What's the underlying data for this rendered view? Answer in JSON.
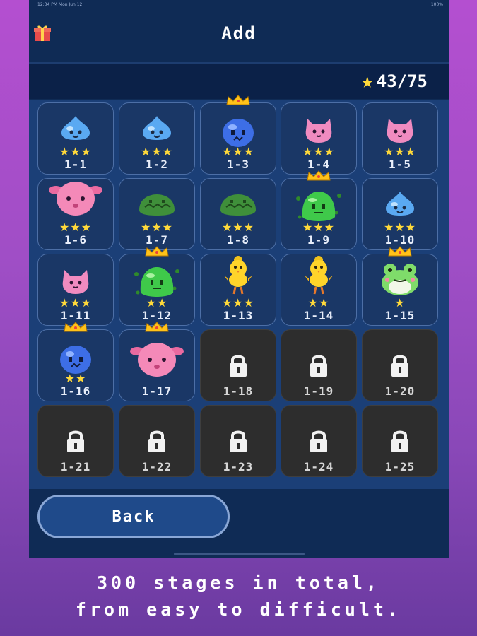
{
  "status_bar": {
    "time": "12:34 PM  Mon Jun 12",
    "battery": "100%"
  },
  "header": {
    "title": "Add"
  },
  "star_total": {
    "value": "43/75"
  },
  "stages": [
    {
      "id": "1-1",
      "stars": "★★★",
      "locked": false,
      "mascot": "blue-slime",
      "crown": false
    },
    {
      "id": "1-2",
      "stars": "★★★",
      "locked": false,
      "mascot": "blue-slime",
      "crown": false
    },
    {
      "id": "1-3",
      "stars": "★★★",
      "locked": false,
      "mascot": "blue-blob",
      "crown": true
    },
    {
      "id": "1-4",
      "stars": "★★★",
      "locked": false,
      "mascot": "pink-cat",
      "crown": false
    },
    {
      "id": "1-5",
      "stars": "★★★",
      "locked": false,
      "mascot": "pink-cat",
      "crown": false
    },
    {
      "id": "1-6",
      "stars": "★★★",
      "locked": false,
      "mascot": "pink-bunny",
      "crown": false
    },
    {
      "id": "1-7",
      "stars": "★★★",
      "locked": false,
      "mascot": "green-slime",
      "crown": false
    },
    {
      "id": "1-8",
      "stars": "★★★",
      "locked": false,
      "mascot": "green-slime",
      "crown": false
    },
    {
      "id": "1-9",
      "stars": "★★★",
      "locked": false,
      "mascot": "green-jelly",
      "crown": true
    },
    {
      "id": "1-10",
      "stars": "★★★",
      "locked": false,
      "mascot": "blue-slime",
      "crown": false
    },
    {
      "id": "1-11",
      "stars": "★★★",
      "locked": false,
      "mascot": "pink-cat",
      "crown": false
    },
    {
      "id": "1-12",
      "stars": "★★",
      "locked": false,
      "mascot": "green-jelly",
      "crown": true
    },
    {
      "id": "1-13",
      "stars": "★★★",
      "locked": false,
      "mascot": "yellow-chick",
      "crown": false
    },
    {
      "id": "1-14",
      "stars": "★★",
      "locked": false,
      "mascot": "yellow-chick",
      "crown": false
    },
    {
      "id": "1-15",
      "stars": "★",
      "locked": false,
      "mascot": "green-frog",
      "crown": true
    },
    {
      "id": "1-16",
      "stars": "★★",
      "locked": false,
      "mascot": "blue-blob",
      "crown": true
    },
    {
      "id": "1-17",
      "stars": "",
      "locked": false,
      "mascot": "pink-bunny",
      "crown": true
    },
    {
      "id": "1-18",
      "stars": "",
      "locked": true
    },
    {
      "id": "1-19",
      "stars": "",
      "locked": true
    },
    {
      "id": "1-20",
      "stars": "",
      "locked": true
    },
    {
      "id": "1-21",
      "stars": "",
      "locked": true
    },
    {
      "id": "1-22",
      "stars": "",
      "locked": true
    },
    {
      "id": "1-23",
      "stars": "",
      "locked": true
    },
    {
      "id": "1-24",
      "stars": "",
      "locked": true
    },
    {
      "id": "1-25",
      "stars": "",
      "locked": true
    }
  ],
  "footer": {
    "back_label": "Back"
  },
  "caption": {
    "line1": "300 stages in total,",
    "line2": "from easy to difficult."
  },
  "colors": {
    "star": "#ffd93a",
    "tile": "#1a3766",
    "locked_tile": "#2d2d2d",
    "background": "#0f2b55"
  }
}
